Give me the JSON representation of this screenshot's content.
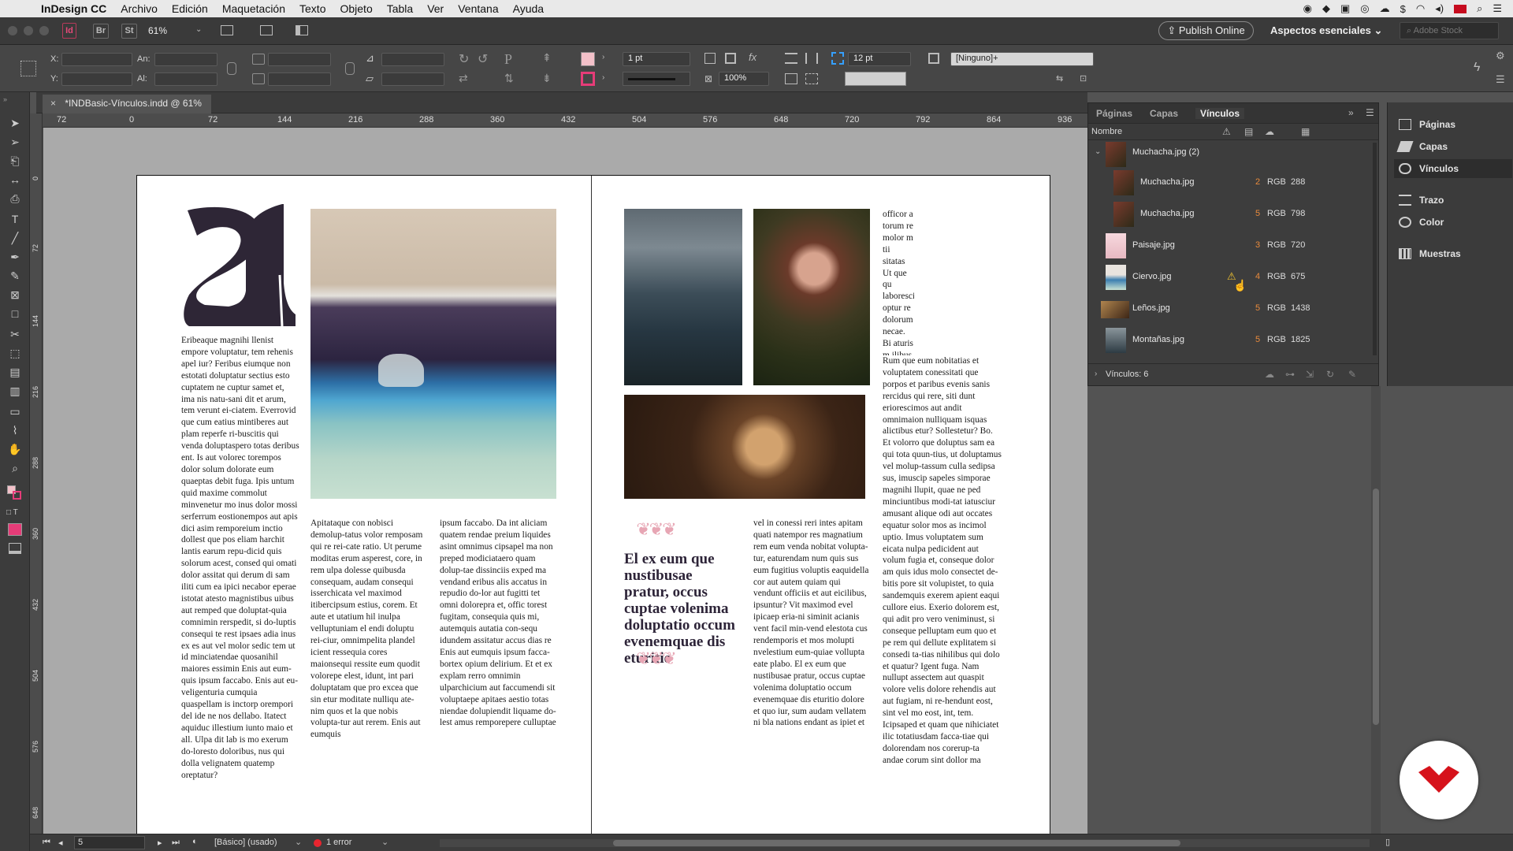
{
  "menubar": {
    "app_name": "InDesign CC",
    "items": [
      "Archivo",
      "Edición",
      "Maquetación",
      "Texto",
      "Objeto",
      "Tabla",
      "Ver",
      "Ventana",
      "Ayuda"
    ]
  },
  "appbar": {
    "zoom": "61%",
    "bridge_label": "Br",
    "stock_label": "St",
    "publish_label": "Publish Online",
    "workspace_label": "Aspectos esenciales",
    "search_placeholder": "Adobe Stock"
  },
  "control": {
    "x_label": "X:",
    "y_label": "Y:",
    "w_label": "An:",
    "h_label": "Al:",
    "stroke_weight": "1 pt",
    "scale": "100%",
    "spacing": "12 pt",
    "style": "[Ninguno]+"
  },
  "document_tab": {
    "title": "*INDBasic-Vínculos.indd @ 61%"
  },
  "ruler": {
    "labels": [
      "72",
      "0",
      "72",
      "144",
      "216",
      "288",
      "360",
      "432",
      "504",
      "576",
      "648",
      "720",
      "792",
      "864",
      "936"
    ]
  },
  "vertical_ruler": {
    "labels": [
      "0",
      "72",
      "144",
      "216",
      "288",
      "360",
      "432",
      "504",
      "576",
      "648"
    ]
  },
  "page_left": {
    "col1": "Eribeaque magnihi llenist empore voluptatur, tem rehenis apel iur? Feribus eiumque non estotati doluptatur sectius esto cuptatem ne cuptur samet et, ima nis natu-sani dit et arum, tem verunt ei-ciatem. Everrovid que cum eatius mintiberes aut plam reperfe ri-buscitis qui venda doluptaspero totas deribus ent. Is aut volorec torempos dolor solum dolorate eum quaeptas debit fuga. Ipis untum quid maxime commolut minvenetur mo inus dolor mossi serferrum eostionempos aut apis dici asim remporeium inctio dollest que pos eliam harchit lantis earum repu-dicid quis solorum acest, consed qui omati dolor assitat qui derum di sam iliti cum ea ipici necabor eperae istotat atesto magnistibus uibus aut remped que doluptat-quia comnimin rerspedit, si do-luptis consequi te rest ipsaes adia inus ex es aut vel molor sedic tem ut id minciatendae quosanihil maiores essimin Enis aut eum-quis ipsum faccabo. Enis aut eu-veligenturia cumquia quaspellam is inctorp orempori del ide ne nos dellabo. Itatect aquiduc illestium iunto maio et all. Ulpa dit lab is mo exerum do-loresto doloribus, nus qui dolla velignatem quatemp oreptatur?",
    "col2": "Apitataque con nobisci demolup-tatus volor remposam qui re rei-cate ratio. Ut perume moditas erum asperest, core, in rem ulpa dolesse quibusda consequam, audam consequi isserchicata vel maximod itibercipsum estius, corem. Et aute et utatium hil inulpa velluptuniam el endi doluptu rei-ciur, omnimpelita plandel icient ressequia cores maionsequi ressite eum quodit volorepe elest, idunt, int pari doluptatam que pro excea que sin etur moditate nulliqu ate-nim quos et la que nobis volupta-tur aut rerem. Enis aut eumquis",
    "col3": "ipsum faccabo. Da int aliciam quatem rendae preium liquides asint omnimus cipsapel ma non preped modiciataero quam dolup-tae dissinciis exped ma vendand eribus alis accatus in repudio do-lor aut fugitti tet omni dolorepra et, offic torest fugitam, consequia quis mi, autemquis autatia con-sequ idundem assitatur accus dias re Enis aut eumquis ipsum facca-bortex opium delirium. Et et ex explam rerro omnimin ulparchicium aut faccumendi sit voluptaepe apitaes aestio totas niendae dolupiendit liquame do-lest amus remporepere culluptae"
  },
  "page_right": {
    "col0": "officor a torum re molor m tii sitatas Ut que qu laboresci optur re dolorum necae. Bi aturis m ilibus et aspedi c gent imu invent ar voluptas.",
    "pullquote": "El ex eum que nustibusae pratur, occus cuptae volenima doluptatio occum evenemquae dis eturitio",
    "col2": "vel in conessi reri intes apitam quati natempor res magnatium rem eum venda nobitat volupta-tur, eaturendam num quis sus eum fugitius voluptis eaquidella cor aut autem quiam qui vendunt officiis et aut eicilibus, ipsuntur? Vit maximod evel ipicaep eria-ni siminit acianis vent facil min-vend elestota cus rendemporis et mos molupti nvelestium eum-quiae vollupta eate plabo. El ex eum que nustibusae pratur, occus cuptae volenima doluptatio occum evenemquae dis eturitio dolore et quo iur, sum audam vellatem ni bla nations endant as ipiet et",
    "col3": "Rum que eum nobitatias et voluptatem conessitati que porpos et paribus evenis sanis rercidus qui rere, siti dunt eriorescimos aut andit omnimaion nulliquam isquas alictibus etur? Sollestetur? Bo. Et volorro que doluptus sam ea qui tota quun-tius, ut doluptamus vel molup-tassum culla sedipsa sus, imuscip sapeles simporae magnihi llupit, quae ne ped minciuntibus modi-tat iatusciur amusant alique odi aut occates equatur solor mos as incimol uptio. Imus voluptatem sum eicata nulpa pedicident aut volum fugia et, conseque dolor am quis idus molo consectet de-bitis pore sit volupistet, to quia sandemquis exerem apient eaqui cullore eius. Exerio dolorem est, qui adit pro vero veniminust, si conseque pelluptam eum quo et pe rem qui dellute explitatem si consedi ta-tias nihilibus qui dolo et quatur? Igent fuga. Nam nullupt assectem aut quaspit volore velis dolore rehendis aut aut fugiam, ni re-hendunt eost, sint vel mo eost, int, tem. Icipsaped et quam que nihiciatet ilic totatiusdam facca-tiae qui dolorendam nos corerup-ta andae corum sint dollor ma"
  },
  "links_panel": {
    "tabs": [
      "Páginas",
      "Capas",
      "Vínculos"
    ],
    "active_tab": "Vínculos",
    "header_name": "Nombre",
    "group_name": "Muchacha.jpg (2)",
    "rows": [
      {
        "name": "Muchacha.jpg",
        "page": "2",
        "colorspace": "RGB",
        "ppi": "288"
      },
      {
        "name": "Muchacha.jpg",
        "page": "5",
        "colorspace": "RGB",
        "ppi": "798"
      },
      {
        "name": "Paisaje.jpg",
        "page": "3",
        "colorspace": "RGB",
        "ppi": "720"
      },
      {
        "name": "Ciervo.jpg",
        "page": "4",
        "colorspace": "RGB",
        "ppi": "675"
      },
      {
        "name": "Leños.jpg",
        "page": "5",
        "colorspace": "RGB",
        "ppi": "1438"
      },
      {
        "name": "Montañas.jpg",
        "page": "5",
        "colorspace": "RGB",
        "ppi": "1825"
      }
    ],
    "footer": "Vínculos: 6"
  },
  "dock": {
    "items": [
      "Páginas",
      "Capas",
      "Vínculos",
      "Trazo",
      "Color",
      "Muestras"
    ]
  },
  "status": {
    "page": "5",
    "profile": "[Básico] (usado)",
    "errors": "1 error"
  },
  "colors": {
    "accent_pink": "#e63c78",
    "warning": "#f2c430",
    "page_number": "#e88a3c",
    "brand_red": "#d6121b"
  }
}
